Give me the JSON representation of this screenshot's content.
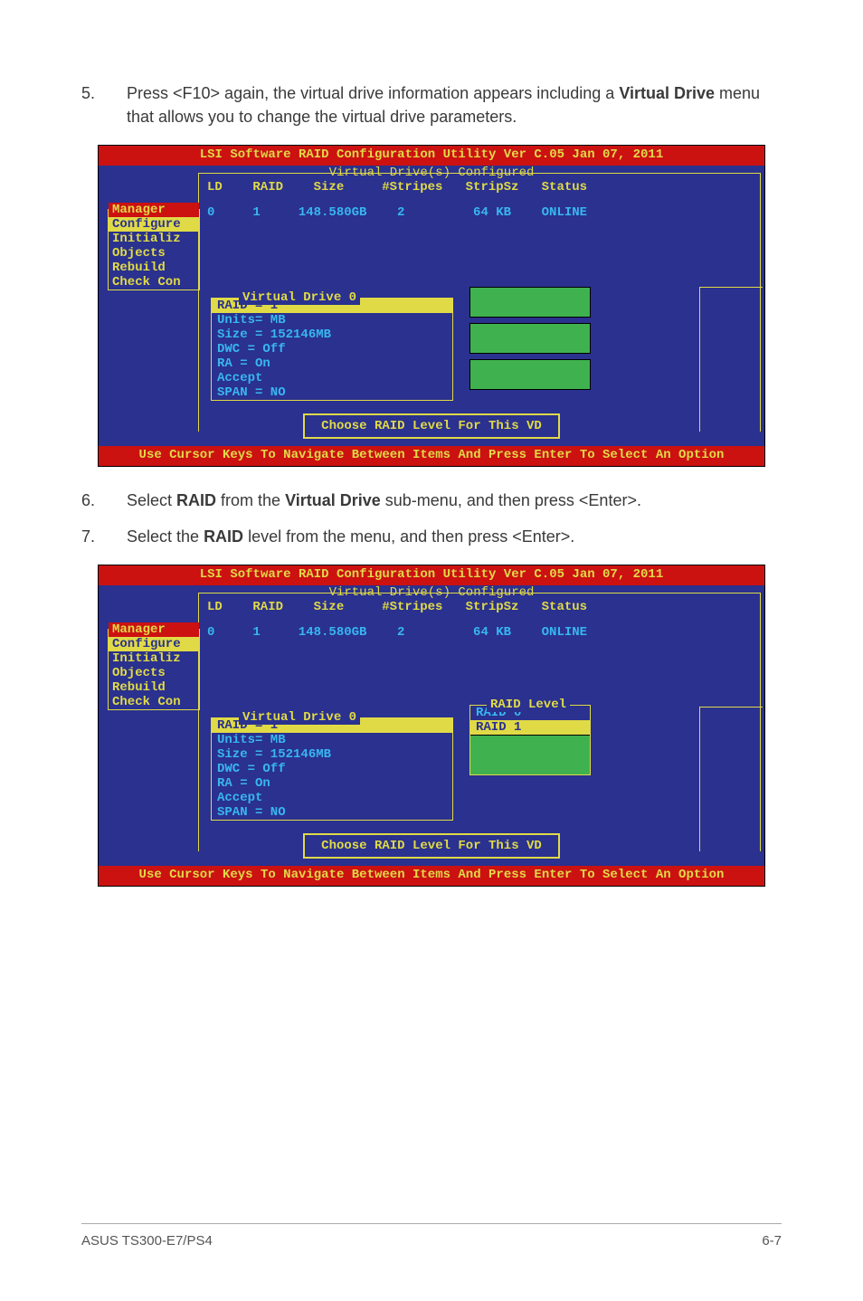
{
  "steps": {
    "s5": {
      "num": "5.",
      "text_a": "Press <F10> again, the virtual drive information appears including a ",
      "bold_a": "Virtual Drive",
      "text_b": " menu that allows you to change the virtual drive parameters."
    },
    "s6": {
      "num": "6.",
      "text_a": "Select ",
      "bold_a": "RAID",
      "text_b": " from the ",
      "bold_b": "Virtual Drive",
      "text_c": " sub-menu, and then press <Enter>."
    },
    "s7": {
      "num": "7.",
      "text_a": "Select the ",
      "bold_a": "RAID",
      "text_b": " level from the menu, and then press <Enter>."
    }
  },
  "bios": {
    "titlebar": "LSI Software RAID Configuration Utility Ver C.05 Jan 07, 2011",
    "vds_configured": "Virtual Drive(s) Configured",
    "columns": "LD    RAID    Size     #Stripes   StripSz   Status",
    "row": "0     1     148.580GB    2         64 KB    ONLINE",
    "sidemenu": [
      "Manager",
      "Configure",
      "Initializ",
      "Objects",
      "Rebuild",
      "Check Con"
    ],
    "vd0_title": "Virtual Drive 0",
    "vd0_items": [
      "RAID = 1",
      "Units= MB",
      "Size = 152146MB",
      "DWC  = Off",
      "RA   = On",
      "Accept",
      "SPAN = NO"
    ],
    "raid_level_title": "RAID Level",
    "raid_levels": [
      "RAID 0",
      "RAID 1"
    ],
    "prompt": "Choose RAID Level For This VD",
    "footer": "Use Cursor Keys To Navigate Between Items And Press Enter To Select An Option"
  },
  "page_footer": {
    "left": "ASUS TS300-E7/PS4",
    "right": "6-7"
  }
}
